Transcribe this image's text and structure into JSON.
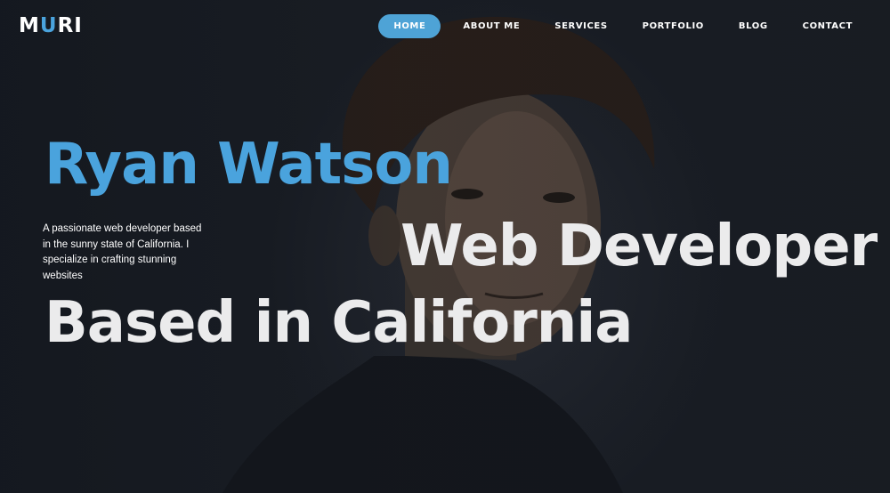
{
  "brand": {
    "logo_prefix": "M",
    "logo_accent": "U",
    "logo_suffix": "RI",
    "accent_color": "#4aa3dd"
  },
  "nav": {
    "items": [
      {
        "label": "HOME",
        "active": true
      },
      {
        "label": "ABOUT ME",
        "active": false
      },
      {
        "label": "SERVICES",
        "active": false
      },
      {
        "label": "PORTFOLIO",
        "active": false
      },
      {
        "label": "BLOG",
        "active": false
      },
      {
        "label": "CONTACT",
        "active": false
      }
    ]
  },
  "hero": {
    "name": "Ryan Watson",
    "intro": "A passionate web developer based in the sunny state of California. I specialize in crafting stunning websites",
    "role": "Web Developer",
    "location": "Based in California",
    "background_color": "#1b2028"
  }
}
